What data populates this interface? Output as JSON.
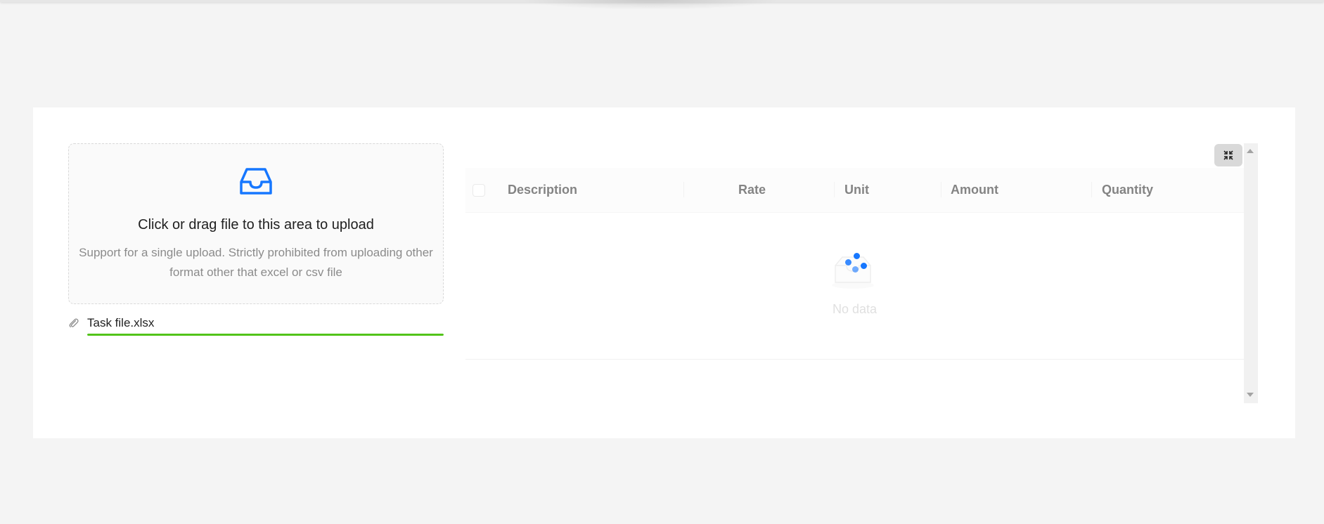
{
  "upload": {
    "title": "Click or drag file to this area to upload",
    "hint": "Support for a single upload. Strictly prohibited from uploading other format other that excel or csv file",
    "icon": "inbox-icon",
    "accent_color": "#1677ff"
  },
  "file": {
    "name": "Task file.xlsx",
    "icon": "paperclip-icon",
    "progress_percent": 100,
    "progress_color": "#52c41a"
  },
  "table": {
    "columns": [
      "Description",
      "Rate",
      "Unit",
      "Amount",
      "Quantity"
    ],
    "empty_text": "No data",
    "loading": true
  },
  "toolbar": {
    "collapse_icon": "collapse-icon"
  }
}
